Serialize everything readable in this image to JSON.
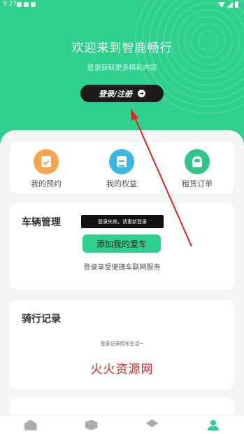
{
  "status_bar": {
    "time": "9:27"
  },
  "hero": {
    "welcome": "欢迎来到智鹿畅行",
    "subtitle": "登录获取更多精彩内容",
    "login_button": "登录/注册"
  },
  "quick_actions": [
    {
      "label": "我的预约",
      "icon": "calendar-check-icon",
      "color": "#f7a44d"
    },
    {
      "label": "我的权益",
      "icon": "document-icon",
      "color": "#37b8e4"
    },
    {
      "label": "租赁订单",
      "icon": "scooter-icon",
      "color": "#2fc58b"
    }
  ],
  "vehicle": {
    "title": "车辆管理",
    "toast": "登录失效，请重新登录",
    "add_button": "添加我的爱车",
    "hint": "登录享受便捷车联网服务"
  },
  "ride_records": {
    "title": "骑行记录",
    "empty_text": "登录记录用车生活~",
    "watermark": "火火资源网"
  },
  "tabbar": [
    {
      "icon": "home-icon",
      "active": false
    },
    {
      "icon": "box-icon",
      "active": false
    },
    {
      "icon": "layers-icon",
      "active": false
    },
    {
      "icon": "user-icon",
      "active": true
    }
  ],
  "colors": {
    "brand": "#2fd08e",
    "annotation_arrow": "#e8201e",
    "watermark": "#e8201e"
  }
}
